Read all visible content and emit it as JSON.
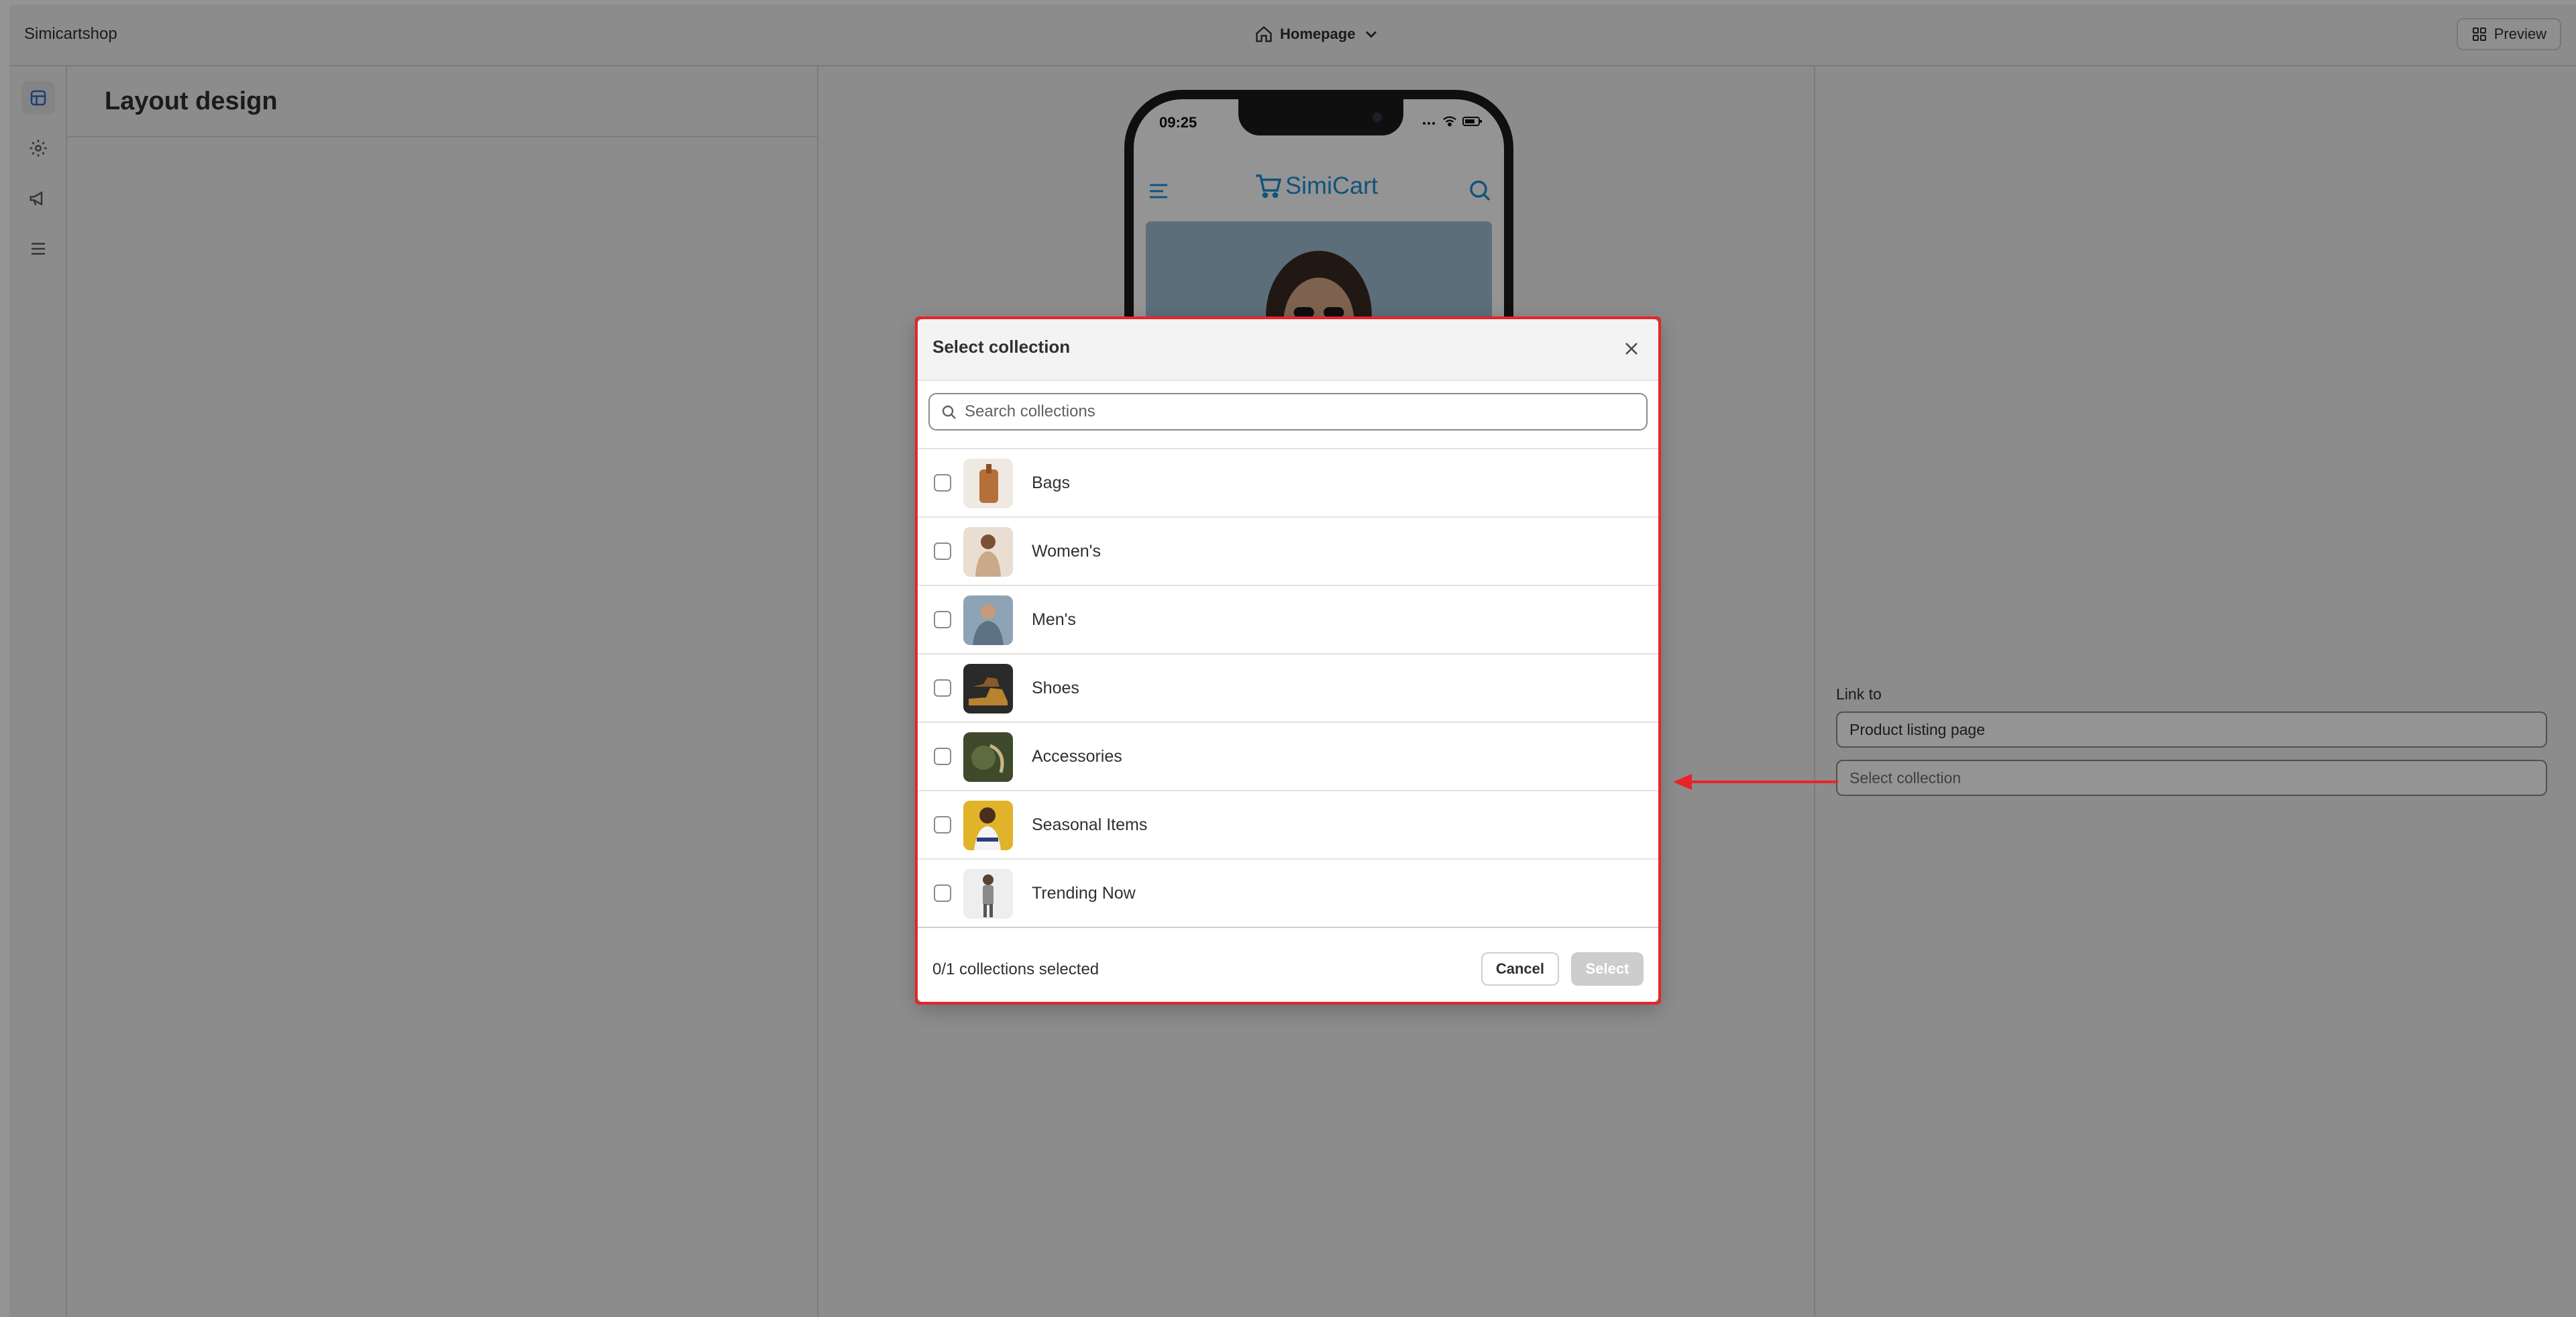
{
  "app": {
    "shop_name": "Simicartshop",
    "page_selector": "Homepage",
    "preview_label": "Preview"
  },
  "rail": {
    "items": [
      {
        "name": "design-icon",
        "active": true
      },
      {
        "name": "gear-icon",
        "active": false
      },
      {
        "name": "megaphone-icon",
        "active": false
      },
      {
        "name": "menu-list-icon",
        "active": false
      }
    ]
  },
  "layout_panel": {
    "title": "Layout design"
  },
  "phone": {
    "time": "09:25",
    "brand_name": "SimiCart"
  },
  "settings": {
    "link_to_label": "Link to",
    "link_type_value": "Product listing page",
    "collection_placeholder": "Select collection"
  },
  "modal": {
    "title": "Select collection",
    "search_placeholder": "Search collections",
    "items": [
      {
        "label": "Bags",
        "thumb_color": "#b5703a"
      },
      {
        "label": "Women's",
        "thumb_color": "#c9a98a"
      },
      {
        "label": "Men's",
        "thumb_color": "#5d7285"
      },
      {
        "label": "Shoes",
        "thumb_color": "#8a5a2a"
      },
      {
        "label": "Accessories",
        "thumb_color": "#5e6b3e"
      },
      {
        "label": "Seasonal Items",
        "thumb_color": "#e0b32a"
      },
      {
        "label": "Trending Now",
        "thumb_color": "#b9b9b9"
      }
    ],
    "selected_count": "0/1 collections selected",
    "cancel_label": "Cancel",
    "select_label": "Select"
  },
  "colors": {
    "highlight": "#e8232a",
    "brand": "#1c8fd6"
  }
}
